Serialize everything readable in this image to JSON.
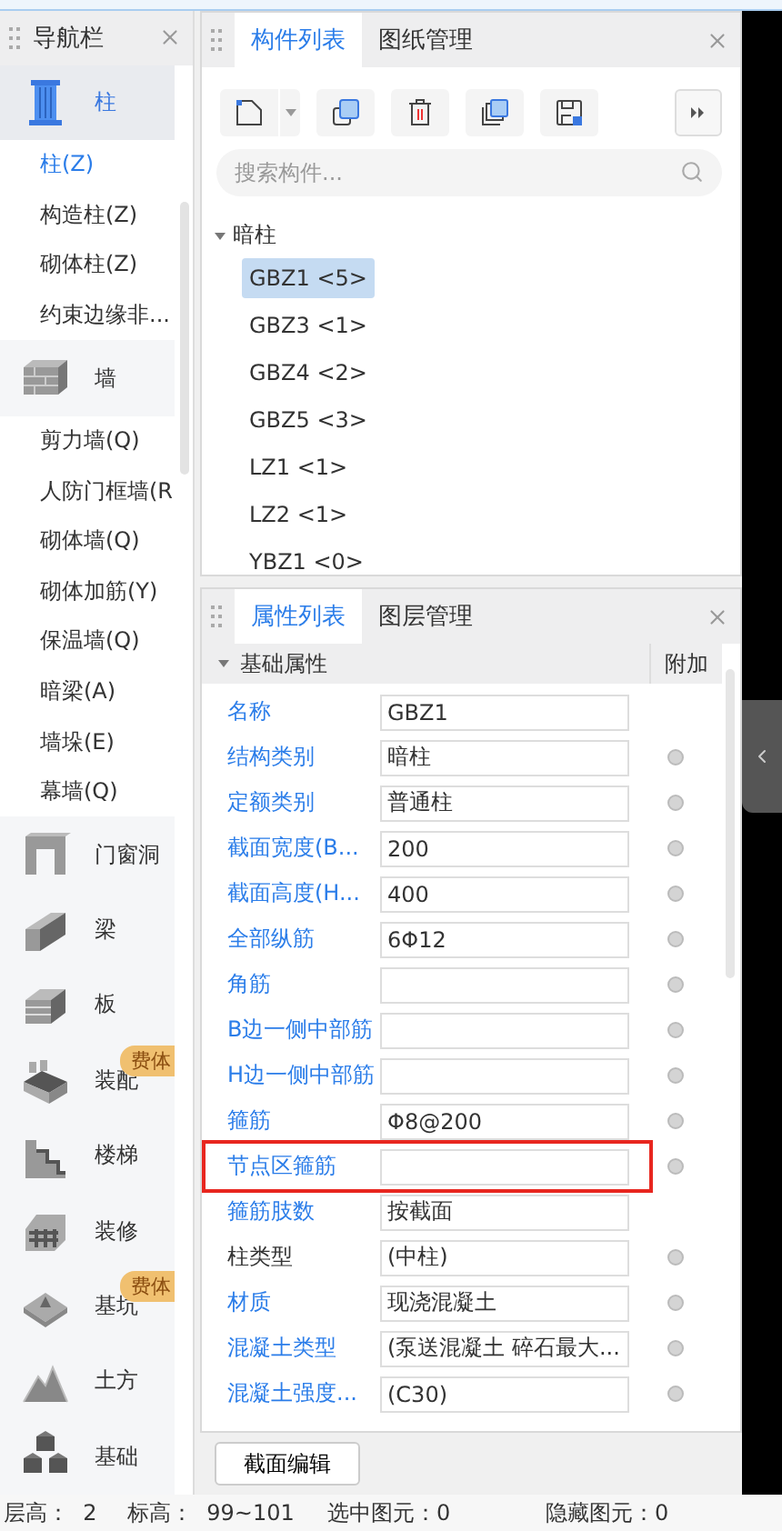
{
  "nav": {
    "title": "导航栏",
    "groups": [
      {
        "kind": "column",
        "label": "柱",
        "selected": true,
        "items": [
          {
            "label": "柱(Z)",
            "selected": true
          },
          {
            "label": "构造柱(Z)",
            "selected": false
          },
          {
            "label": "砌体柱(Z)",
            "selected": false
          },
          {
            "label": "约束边缘非...",
            "selected": false
          }
        ]
      },
      {
        "kind": "wall",
        "label": "墙",
        "selected": false,
        "items": [
          {
            "label": "剪力墙(Q)",
            "selected": false
          },
          {
            "label": "人防门框墙(R",
            "selected": false
          },
          {
            "label": "砌体墙(Q)",
            "selected": false
          },
          {
            "label": "砌体加筋(Y)",
            "selected": false
          },
          {
            "label": "保温墙(Q)",
            "selected": false
          },
          {
            "label": "暗梁(A)",
            "selected": false
          },
          {
            "label": "墙垛(E)",
            "selected": false
          },
          {
            "label": "幕墙(Q)",
            "selected": false
          }
        ]
      },
      {
        "kind": "opening",
        "label": "门窗洞",
        "selected": false
      },
      {
        "kind": "beam",
        "label": "梁",
        "selected": false
      },
      {
        "kind": "slab",
        "label": "板",
        "selected": false
      },
      {
        "kind": "prefab",
        "label": "装配",
        "selected": false,
        "badge": "费体"
      },
      {
        "kind": "stair",
        "label": "楼梯",
        "selected": false
      },
      {
        "kind": "finish",
        "label": "装修",
        "selected": false
      },
      {
        "kind": "pit",
        "label": "基坑",
        "selected": false,
        "badge": "费体"
      },
      {
        "kind": "earth",
        "label": "土方",
        "selected": false
      },
      {
        "kind": "foundation",
        "label": "基础",
        "selected": false
      }
    ]
  },
  "components": {
    "tabs": [
      {
        "label": "构件列表",
        "selected": true
      },
      {
        "label": "图纸管理",
        "selected": false
      }
    ],
    "search": {
      "placeholder": "搜索构件..."
    },
    "tree": [
      {
        "label": "暗柱",
        "expanded": true,
        "children": [
          {
            "label": "GBZ1 <5>",
            "selected": true
          },
          {
            "label": "GBZ3 <1>",
            "selected": false
          },
          {
            "label": "GBZ4 <2>",
            "selected": false
          },
          {
            "label": "GBZ5 <3>",
            "selected": false
          },
          {
            "label": "LZ1 <1>",
            "selected": false
          },
          {
            "label": "LZ2 <1>",
            "selected": false
          },
          {
            "label": "YBZ1 <0>",
            "selected": false
          }
        ]
      }
    ]
  },
  "properties": {
    "tabs": [
      {
        "label": "属性列表",
        "selected": true
      },
      {
        "label": "图层管理",
        "selected": false
      }
    ],
    "group": {
      "label": "基础属性",
      "expanded": true,
      "column_2": "附加"
    },
    "rows": [
      {
        "name": "名称",
        "value": "GBZ1",
        "public": true,
        "option": false,
        "highlighted": false
      },
      {
        "name": "结构类别",
        "value": "暗柱",
        "public": true,
        "option": true,
        "highlighted": false
      },
      {
        "name": "定额类别",
        "value": "普通柱",
        "public": true,
        "option": true,
        "highlighted": false
      },
      {
        "name": "截面宽度(B...",
        "value": "200",
        "public": true,
        "option": true,
        "highlighted": false
      },
      {
        "name": "截面高度(H...",
        "value": "400",
        "public": true,
        "option": true,
        "highlighted": false
      },
      {
        "name": "全部纵筋",
        "value": "6Φ12",
        "public": true,
        "option": true,
        "highlighted": false
      },
      {
        "name": "角筋",
        "public": true,
        "option": true,
        "highlighted": false
      },
      {
        "name": "B边一侧中部筋",
        "public": true,
        "option": true,
        "highlighted": false
      },
      {
        "name": "H边一侧中部筋",
        "public": true,
        "option": true,
        "highlighted": false
      },
      {
        "name": "箍筋",
        "value": "Φ8@200",
        "public": true,
        "option": true,
        "highlighted": false
      },
      {
        "name": "节点区箍筋",
        "public": true,
        "option": true,
        "highlighted": true
      },
      {
        "name": "箍筋肢数",
        "value": "按截面",
        "public": true,
        "option": false,
        "highlighted": false
      },
      {
        "name": "柱类型",
        "value": "(中柱)",
        "public": false,
        "option": true,
        "highlighted": false
      },
      {
        "name": "材质",
        "value": "现浇混凝土",
        "public": true,
        "option": true,
        "highlighted": false
      },
      {
        "name": "混凝土类型",
        "value": "(泵送混凝土 碎石最大...",
        "public": true,
        "option": true,
        "highlighted": false
      },
      {
        "name": "混凝土强度...",
        "value": "(C30)",
        "public": true,
        "option": true,
        "highlighted": false
      }
    ],
    "button": "截面编辑"
  },
  "status_bar": [
    "层高：  2",
    "标高：  99~101",
    "选中图元：0",
    "隐藏图元：0"
  ]
}
